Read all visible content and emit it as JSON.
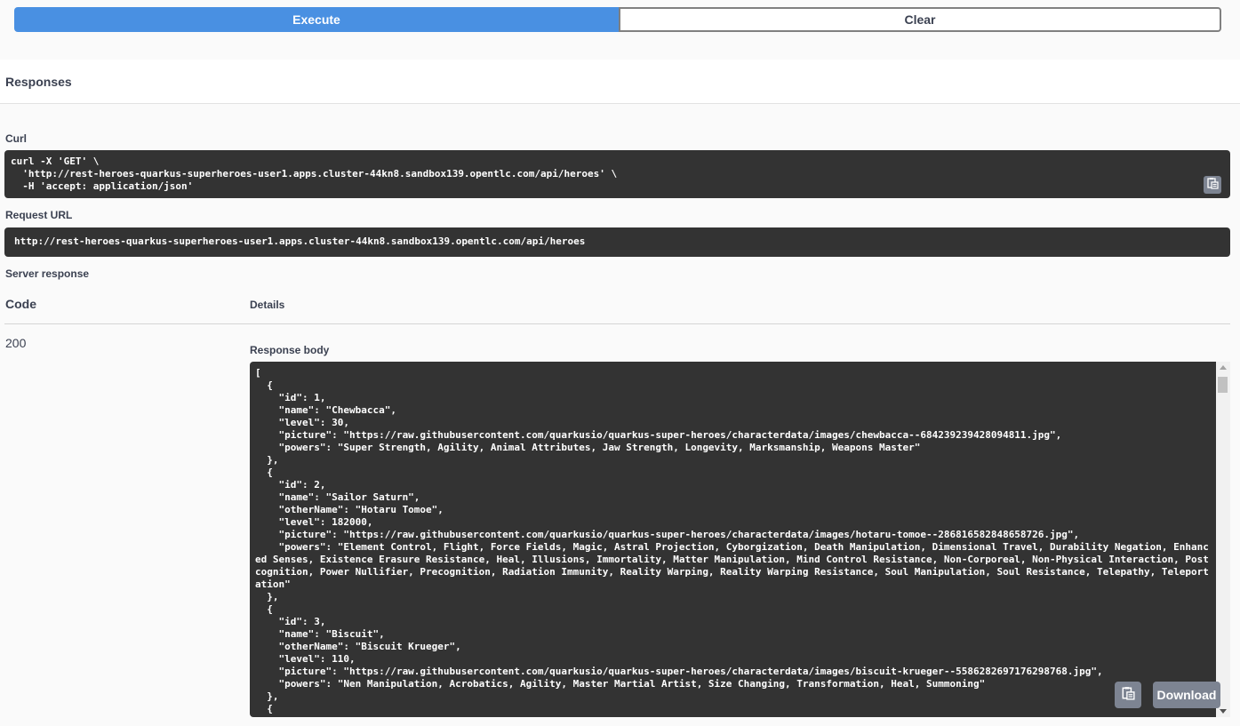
{
  "buttons": {
    "execute": "Execute",
    "clear": "Clear"
  },
  "responses": {
    "title": "Responses"
  },
  "curl": {
    "label": "Curl",
    "lines": [
      "curl -X 'GET' \\",
      "  'http://rest-heroes-quarkus-superheroes-user1.apps.cluster-44kn8.sandbox139.opentlc.com/api/heroes' \\",
      "  -H 'accept: application/json'"
    ]
  },
  "request_url": {
    "label": "Request URL",
    "value": "http://rest-heroes-quarkus-superheroes-user1.apps.cluster-44kn8.sandbox139.opentlc.com/api/heroes"
  },
  "server_response": {
    "label": "Server response",
    "code_header": "Code",
    "details_header": "Details",
    "status_code": "200",
    "response_body_label": "Response body",
    "body_lines": [
      "[",
      "  {",
      "    \"id\": 1,",
      "    \"name\": \"Chewbacca\",",
      "    \"level\": 30,",
      "    \"picture\": \"https://raw.githubusercontent.com/quarkusio/quarkus-super-heroes/characterdata/images/chewbacca--684239239428094811.jpg\",",
      "    \"powers\": \"Super Strength, Agility, Animal Attributes, Jaw Strength, Longevity, Marksmanship, Weapons Master\"",
      "  },",
      "  {",
      "    \"id\": 2,",
      "    \"name\": \"Sailor Saturn\",",
      "    \"otherName\": \"Hotaru Tomoe\",",
      "    \"level\": 182000,",
      "    \"picture\": \"https://raw.githubusercontent.com/quarkusio/quarkus-super-heroes/characterdata/images/hotaru-tomoe--286816582848658726.jpg\",",
      "    \"powers\": \"Element Control, Flight, Force Fields, Magic, Astral Projection, Cyborgization, Death Manipulation, Dimensional Travel, Durability Negation, Enhanc",
      "ed Senses, Existence Erasure Resistance, Heal, Illusions, Immortality, Matter Manipulation, Mind Control Resistance, Non-Corporeal, Non-Physical Interaction, Post",
      "cognition, Power Nullifier, Precognition, Radiation Immunity, Reality Warping, Reality Warping Resistance, Soul Manipulation, Soul Resistance, Telepathy, Teleport",
      "ation\"",
      "  },",
      "  {",
      "    \"id\": 3,",
      "    \"name\": \"Biscuit\",",
      "    \"otherName\": \"Biscuit Krueger\",",
      "    \"level\": 110,",
      "    \"picture\": \"https://raw.githubusercontent.com/quarkusio/quarkus-super-heroes/characterdata/images/biscuit-krueger--5586282697176298768.jpg\",",
      "    \"powers\": \"Nen Manipulation, Acrobatics, Agility, Master Martial Artist, Size Changing, Transformation, Heal, Summoning\"",
      "  },",
      "  {"
    ],
    "download_label": "Download"
  },
  "colors": {
    "execute": "#4990e2",
    "code_bg": "#333333",
    "grey_button": "#7d8492"
  },
  "icons": {
    "copy": "clipboard-icon"
  }
}
